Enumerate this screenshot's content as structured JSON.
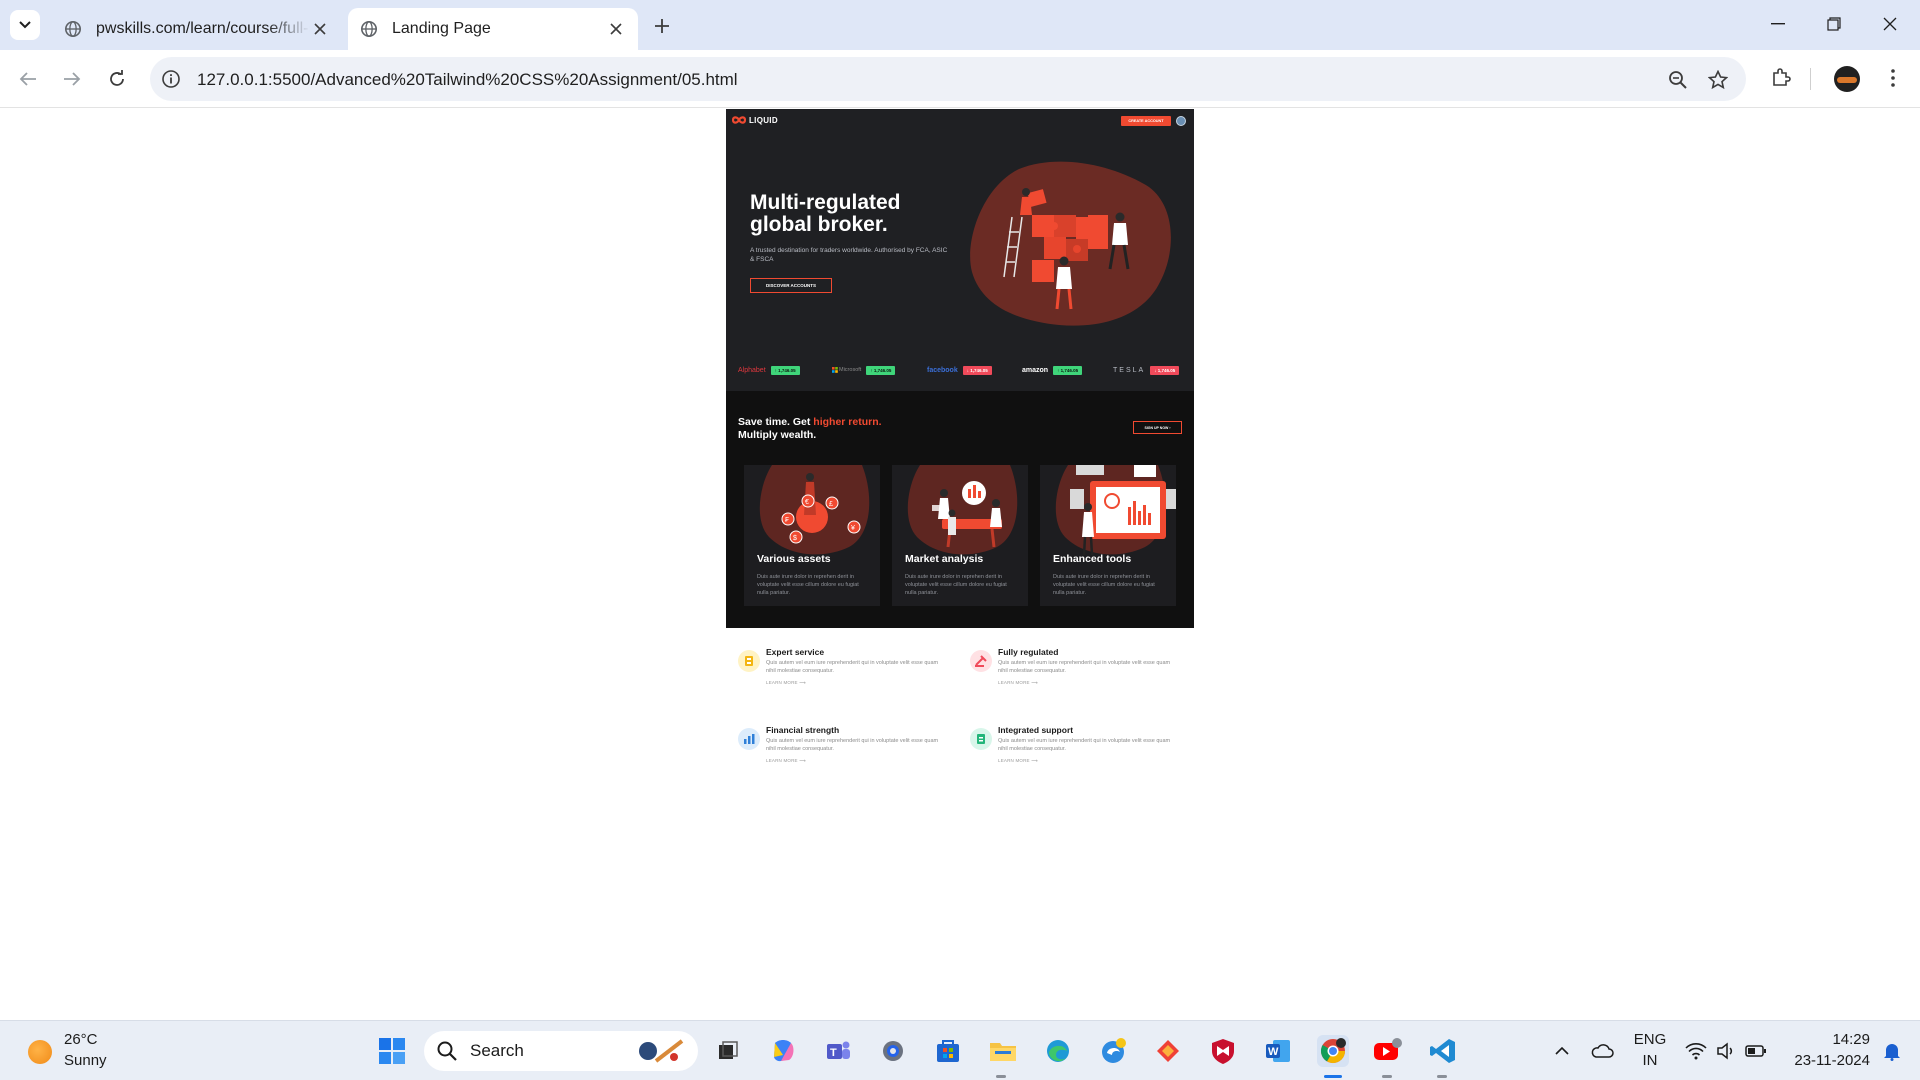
{
  "browser": {
    "tabs": [
      {
        "title": "pwskills.com/learn/course/full-s",
        "active": false
      },
      {
        "title": "Landing Page",
        "active": true
      }
    ],
    "url": "127.0.0.1:5500/Advanced%20Tailwind%20CSS%20Assignment/05.html"
  },
  "site": {
    "logo": "LIQUID",
    "create_account": "CREATE ACCOUNT",
    "hero": {
      "title_line1": "Multi-regulated",
      "title_line2": "global broker.",
      "subtitle": "A trusted destination for traders worldwide. Authorised by FCA, ASIC & FSCA",
      "button": "DISCOVER ACCOUNTS"
    },
    "ticker": [
      {
        "brand": "Alphabet",
        "value": "↑ 1,746.05",
        "direction": "up",
        "color": "#e0383e"
      },
      {
        "brand": "Microsoft",
        "value": "↑ 1,746.05",
        "direction": "up",
        "color": "#7f7f7f"
      },
      {
        "brand": "facebook",
        "value": "↓ 1,746.05",
        "direction": "down",
        "color": "#1877f2"
      },
      {
        "brand": "amazon",
        "value": "↑ 1,746.05",
        "direction": "up",
        "color": "#ffffff"
      },
      {
        "brand": "TESLA",
        "value": "↓ 1,746.05",
        "direction": "down",
        "color": "#b8bcc4"
      }
    ],
    "features": {
      "heading_part1": "Save time. Get ",
      "heading_highlight": "higher return.",
      "heading_line2": "Multiply wealth.",
      "button": "SIGN UP NOW ›",
      "cards": [
        {
          "title": "Various assets",
          "text": "Duis aute irure dolor in reprehen derit in voluptate velit esse cillum dolore eu fugiat nulla pariatur."
        },
        {
          "title": "Market analysis",
          "text": "Duis aute irure dolor in reprehen derit in voluptate velit esse cillum dolore eu fugiat nulla pariatur."
        },
        {
          "title": "Enhanced tools",
          "text": "Duis aute irure dolor in reprehen derit in voluptate velit esse cillum dolore eu fugiat nulla pariatur."
        }
      ]
    },
    "services": [
      {
        "title": "Expert service",
        "text": "Quis autem vel eum iure reprehenderit qui in voluptate velit esse quam nihil molestiae consequatur.",
        "link": "LEARN MORE ⟶"
      },
      {
        "title": "Fully regulated",
        "text": "Quis autem vel eum iure reprehenderit qui in voluptate velit esse quam nihil molestiae consequatur.",
        "link": "LEARN MORE ⟶"
      },
      {
        "title": "Financial strength",
        "text": "Quis autem vel eum iure reprehenderit qui in voluptate velit esse quam nihil molestiae consequatur.",
        "link": "LEARN MORE ⟶"
      },
      {
        "title": "Integrated support",
        "text": "Quis autem vel eum iure reprehenderit qui in voluptate velit esse quam nihil molestiae consequatur.",
        "link": "LEARN MORE ⟶"
      }
    ]
  },
  "taskbar": {
    "weather_temp": "26°C",
    "weather_condition": "Sunny",
    "search_label": "Search",
    "lang_line1": "ENG",
    "lang_line2": "IN",
    "time": "14:29",
    "date": "23-11-2024"
  },
  "colors": {
    "accent": "#f04a31",
    "hero_bg": "#1f2023",
    "features_bg": "#101010",
    "tabbar_bg": "#dfe7f7"
  }
}
